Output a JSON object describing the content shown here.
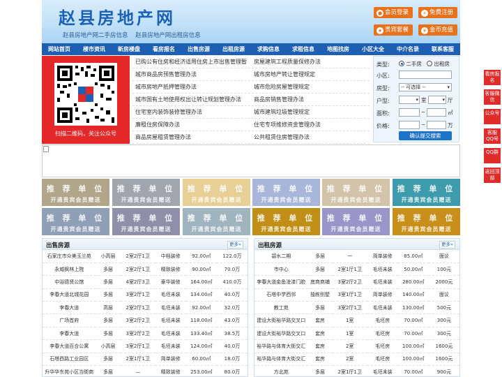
{
  "header": {
    "city_title": "赵县房地产网",
    "sub_links": [
      "赵县房地产网二手房信息",
      "赵县房地产网出租房信息"
    ],
    "buttons": [
      {
        "label": "会员登录",
        "icon": "user-icon"
      },
      {
        "label": "免费注册",
        "icon": "register-icon"
      },
      {
        "label": "贵宾套餐",
        "icon": "vip-icon"
      },
      {
        "label": "金币充值",
        "icon": "coin-icon"
      }
    ]
  },
  "nav": [
    "网站首页",
    "楼市资讯",
    "新房楼盘",
    "看房报名",
    "出售房源",
    "出租房源",
    "求购信息",
    "求租信息",
    "地图找房",
    "小区大全",
    "中介名录",
    "联系客服"
  ],
  "qr": {
    "caption": "扫描二维码，关注公众号"
  },
  "links": [
    [
      "已购公有住房和经济适用住房上市出售管理暂",
      "房屋建筑工程质量保修办法"
    ],
    [
      "城市商品房预售管理办法",
      "城市房地产转让管理规定"
    ],
    [
      "城市房地产抵押管理办法",
      "城市危险房屋管理规定"
    ],
    [
      "城市国有土地使用权出让转让规划管理办法",
      "商品房销售管理办法"
    ],
    [
      "住宅室内装饰装修管理办法",
      "城市建筑垃圾管理规定"
    ],
    [
      "廉租住房保障办法",
      "住宅专项维修资金管理办法"
    ],
    [
      "商品房屋租赁管理办法",
      "公共租赁住房管理办法"
    ]
  ],
  "search": {
    "type_label": "类型:",
    "type_options": [
      "二手房",
      "出租房"
    ],
    "community_label": "小区:",
    "property_label": "房型:",
    "property_placeholder": "-- 可选择 --",
    "layout_label": "户型:",
    "room_unit": "室",
    "hall_unit": "厅",
    "area_label": "面积:",
    "area_unit": "㎡",
    "price_label": "价格:",
    "price_unit": "万",
    "range_sep": "~",
    "submit": "确认提交搜索"
  },
  "tiles": {
    "line1": "推 荐 单 位",
    "line2": "开通贵宾会员赠送",
    "colors": [
      "#b1a58a",
      "#a0a5ae",
      "#e7cf95",
      "#a8b6d9",
      "#d2c3a9",
      "#3e9bab",
      "#8fa0b6",
      "#8f8fa9",
      "#a0b4c0",
      "#c18f18",
      "#9a95c8",
      "#c8901a"
    ]
  },
  "sale": {
    "title": "出售房源",
    "more": "更多",
    "rows": [
      [
        "石家庄市众美玉兰苑",
        "小高层",
        "2室2厅1卫",
        "中档装修",
        "92.00㎡",
        "122.0万"
      ],
      [
        "永威枫林上院",
        "多层",
        "2室2厅1卫",
        "精致装修",
        "90.00㎡",
        "70.0万"
      ],
      [
        "中浴德贤公馆",
        "多层",
        "4室2厅3卫",
        "豪华装修",
        "164.00㎡",
        "410.0万"
      ],
      [
        "李春大道北城花园",
        "多层",
        "3室2厅1卫",
        "毛坯未装",
        "134.00㎡",
        "40.0万"
      ],
      [
        "李春大道",
        "高层",
        "2室2厅1卫",
        "毛坯未装",
        "92.00㎡",
        "32.0万"
      ],
      [
        "广场首府",
        "多层",
        "3室2厅2卫",
        "毛坯未装",
        "118.00㎡",
        "43.0万"
      ],
      [
        "李春大道",
        "多层",
        "3室2厅2卫",
        "毛坯未装",
        "133.40㎡",
        "38.5万"
      ],
      [
        "李春大道百合公寓",
        "小高层",
        "3室2厅1卫",
        "毛坯未装",
        "124.00㎡",
        "40.0万"
      ],
      [
        "石塔西路工业园区",
        "多层",
        "2室1厅1卫",
        "简单装修",
        "60.00㎡",
        "18.0万"
      ],
      [
        "升华华东苑小区当街商",
        "多层",
        "—",
        "精致装修",
        "253.00㎡",
        "80.0万"
      ]
    ]
  },
  "rent": {
    "title": "出租房源",
    "more": "更多",
    "rows": [
      [
        "碧水二期",
        "多层",
        "一",
        "简单装修",
        "85.00㎡",
        "面议"
      ],
      [
        "市中心",
        "多层",
        "2室1厅1卫",
        "毛坯未装",
        "50.00㎡",
        "100元"
      ],
      [
        "李春大道金鱼淦漆门脸",
        "底商商铺",
        "3室2厅2卫",
        "毛坯未装",
        "280.00㎡",
        "2000元"
      ],
      [
        "石塔中学西邻",
        "独栋别墅",
        "3室1厅1卫",
        "简单装修",
        "140.00㎡",
        "面议"
      ],
      [
        "教工苑",
        "多层",
        "3室2厅1卫",
        "毛坯未装",
        "130.00㎡",
        "500元"
      ],
      [
        "建设大街裕华路交叉口",
        "套房",
        "1室",
        "毛坯房",
        "70.00㎡",
        "300元"
      ],
      [
        "建设大街裕华路交叉口",
        "套房",
        "1室",
        "毛坯房",
        "70.00㎡",
        "300元"
      ],
      [
        "裕华路与体育大街交汇",
        "套房",
        "2室",
        "毛坯房",
        "100.00㎡",
        "1600元"
      ],
      [
        "裕华路与体育大街交汇",
        "套房",
        "2室",
        "毛坯房",
        "100.00㎡",
        "1600元"
      ],
      [
        "方北苑",
        "多层",
        "2室1厅1卫",
        "毛坯未装",
        "70.00㎡",
        "900元"
      ]
    ]
  },
  "side": [
    "看房报名",
    "客服微信",
    "公众号",
    "客服QQ号",
    "QQ群",
    "返回顶部"
  ]
}
